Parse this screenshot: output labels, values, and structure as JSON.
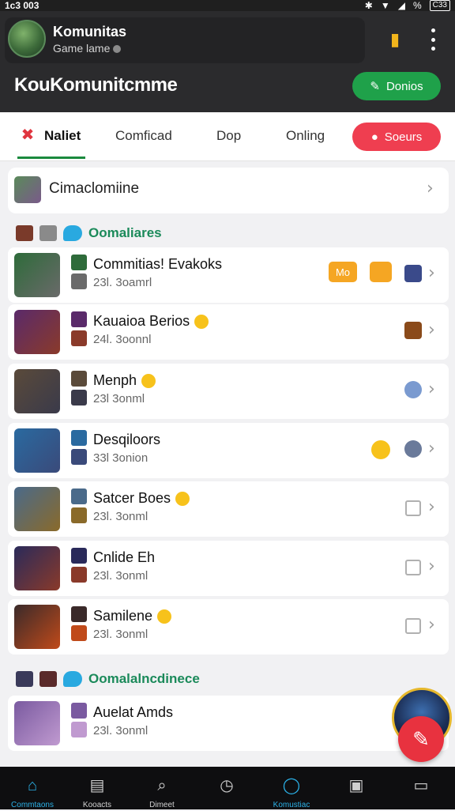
{
  "status": {
    "time": "1c3 003",
    "signal": "%",
    "battery": "C33"
  },
  "header": {
    "name": "Komunitas",
    "sub": "Game lame",
    "title": "KouKomunitcmme",
    "donate_label": "Donios"
  },
  "tabs": [
    {
      "label": "Naliet",
      "active": true
    },
    {
      "label": "Comficad"
    },
    {
      "label": "Dop"
    },
    {
      "label": "Onling"
    }
  ],
  "search_label": "Soeurs",
  "featured": {
    "label": "Cimaclomiine"
  },
  "sections": [
    {
      "title": "Oomaliares"
    },
    {
      "title": "Oomalalncdinece"
    }
  ],
  "rows": [
    {
      "name": "Commitias! Evakoks",
      "meta": "23l. 3oamrl",
      "badge1": "Mo",
      "colors": [
        "#2e6b3a",
        "#6a6a6a"
      ]
    },
    {
      "name": "Kauaioa Berios",
      "meta": "24l. 3oonnl",
      "emoji": true,
      "colors": [
        "#5a2a6a",
        "#8a3a2a"
      ]
    },
    {
      "name": "Menph",
      "meta": "23l 3onml",
      "emoji": true,
      "colors": [
        "#5a4a3a",
        "#3a3a4a"
      ]
    },
    {
      "name": "Desqiloors",
      "meta": "33l 3onion",
      "colors": [
        "#2a6aa0",
        "#3a4a7a"
      ]
    },
    {
      "name": "Satcer Boes",
      "meta": "23l. 3onml",
      "emoji": true,
      "colors": [
        "#4a6a8a",
        "#8a6a2a"
      ]
    },
    {
      "name": "Cnlide Eh",
      "meta": "23l. 3onml",
      "colors": [
        "#2a2a5a",
        "#8a3a2a"
      ]
    },
    {
      "name": "Samilene",
      "meta": "23l. 3onml",
      "emoji": true,
      "colors": [
        "#3a2a2a",
        "#c04a1a"
      ]
    },
    {
      "name": "Auelat Amds",
      "meta": "23l. 3onml",
      "colors": [
        "#7a5aa0",
        "#c09ad0"
      ]
    }
  ],
  "bottom_nav": [
    {
      "label": "Commtaons",
      "icon": "home-icon",
      "active": true
    },
    {
      "label": "Kooacts",
      "icon": "book-icon"
    },
    {
      "label": "Dimeet",
      "icon": "search-icon"
    },
    {
      "label": "",
      "icon": "compass-icon"
    },
    {
      "label": "Komustiac",
      "icon": "chat-icon",
      "active": true
    },
    {
      "label": "",
      "icon": "image-icon"
    },
    {
      "label": "",
      "icon": "window-icon"
    }
  ],
  "colors": {
    "accent": "#1fa14a",
    "danger": "#ef3e50",
    "link": "#2bb0e6"
  }
}
